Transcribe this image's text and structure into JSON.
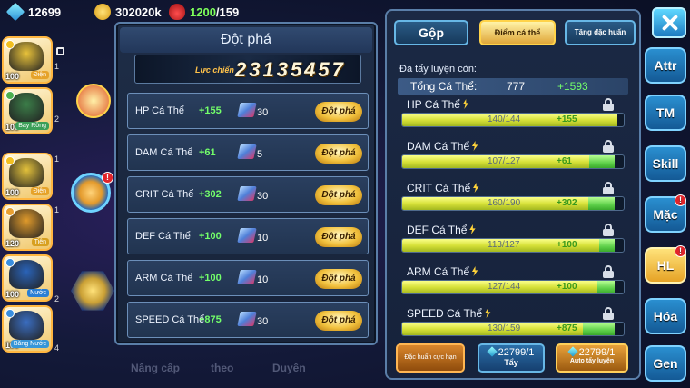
{
  "resources": {
    "diamonds": "12699",
    "gold": "302020k",
    "potion_current": "1200",
    "potion_max": "/159"
  },
  "team": [
    {
      "level": "100",
      "tag": "Điện",
      "tag_color": "#e6a32a",
      "mon_color": "#e8c23a",
      "elem_color": "#f2c020",
      "num": "1"
    },
    {
      "level": "100",
      "tag": "Bay Rồng",
      "tag_color": "#3b9f58",
      "mon_color": "#3b7d48",
      "elem_color": "#4caf50",
      "num": "2"
    },
    {
      "level": "100",
      "tag": "Điện",
      "tag_color": "#e6a32a",
      "mon_color": "#e3c13b",
      "elem_color": "#f2c020",
      "num": "1"
    },
    {
      "level": "120",
      "tag": "Tiên",
      "tag_color": "#d8a020",
      "mon_color": "#e09a2b",
      "elem_color": "#e9a030",
      "num": "1"
    },
    {
      "level": "100",
      "tag": "Nước",
      "tag_color": "#2a7fd4",
      "mon_color": "#2a63b8",
      "elem_color": "#3a8fe0",
      "num": "2"
    },
    {
      "level": "100",
      "tag": "Băng Nước",
      "tag_color": "#3796d8",
      "mon_color": "#3a6dc0",
      "elem_color": "#3a8fe0",
      "num": "4"
    }
  ],
  "middle": {
    "ghost_1": "Nâng cấp",
    "ghost_2": "theo",
    "ghost_3": "Duyên",
    "alert": "!"
  },
  "breakthrough": {
    "title": "Đột phá",
    "power_label": "Lực chiến",
    "power_value": "23135457",
    "rows": [
      {
        "name": "HP Cá Thể",
        "bonus": "+155",
        "cost": "30",
        "button": "Đột phá"
      },
      {
        "name": "DAM Cá Thể",
        "bonus": "+61",
        "cost": "5",
        "button": "Đột phá"
      },
      {
        "name": "CRIT Cá Thể",
        "bonus": "+302",
        "cost": "30",
        "button": "Đột phá"
      },
      {
        "name": "DEF Cá Thể",
        "bonus": "+100",
        "cost": "10",
        "button": "Đột phá"
      },
      {
        "name": "ARM Cá Thể",
        "bonus": "+100",
        "cost": "10",
        "button": "Đột phá"
      },
      {
        "name": "SPEED Cá Thể",
        "bonus": "+875",
        "cost": "30",
        "button": "Đột phá"
      }
    ]
  },
  "individual": {
    "tabs": {
      "merge": "Gộp",
      "stat_points": "Điểm cá thể",
      "special": "Tăng đặc huấn"
    },
    "remaining_label": "Đá tẩy luyện còn:",
    "total_label": "Tổng Cá Thể:",
    "total_value": "777",
    "total_bonus": "+1593",
    "stats": [
      {
        "name": "HP Cá Thể",
        "current": 140,
        "max": 144,
        "text": "140/144",
        "bonus": "+155"
      },
      {
        "name": "DAM Cá Thể",
        "current": 107,
        "max": 127,
        "text": "107/127",
        "bonus": "+61"
      },
      {
        "name": "CRIT Cá Thể",
        "current": 160,
        "max": 190,
        "text": "160/190",
        "bonus": "+302"
      },
      {
        "name": "DEF Cá Thể",
        "current": 113,
        "max": 127,
        "text": "113/127",
        "bonus": "+100"
      },
      {
        "name": "ARM Cá Thể",
        "current": 127,
        "max": 144,
        "text": "127/144",
        "bonus": "+100"
      },
      {
        "name": "SPEED Cá Thể",
        "current": 130,
        "max": 159,
        "text": "130/159",
        "bonus": "+875"
      }
    ],
    "buttons": {
      "special_training": "Đặc huấn cực hạn",
      "wash_count": "22799/1",
      "wash_label": "Tẩy",
      "auto_count": "22799/1",
      "auto_label": "Auto tẩy luyện"
    }
  },
  "side_menu": {
    "items": [
      "Attr",
      "TM",
      "Skill",
      "Mặc",
      "HL",
      "Hóa",
      "Gen"
    ],
    "active": "HL",
    "alert": "!"
  }
}
